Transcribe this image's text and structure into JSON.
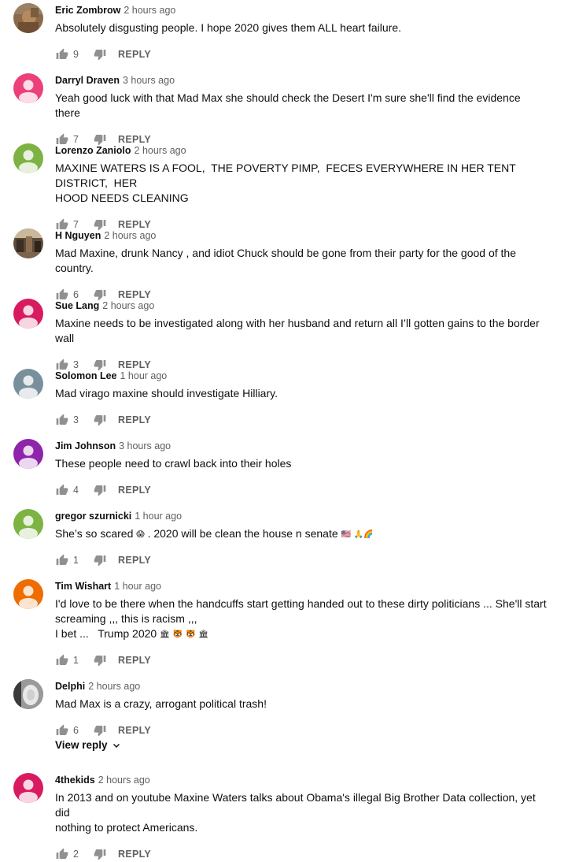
{
  "actions": {
    "reply_label": "REPLY"
  },
  "comments": [
    {
      "author": "Eric Zombrow",
      "time": "2 hours ago",
      "text": "Absolutely disgusting people. I hope 2020 gives them ALL heart failure.",
      "likes": "9",
      "avatar": {
        "kind": "photo",
        "color": "#8a6a4a"
      }
    },
    {
      "author": "Darryl Draven",
      "time": "3 hours ago",
      "text": "Yeah good luck with that Mad Max she should check the Desert I'm sure she'll find the evidence there",
      "likes": "7",
      "avatar": {
        "kind": "default",
        "color": "#ec407a"
      }
    },
    {
      "author": "Lorenzo Zaniolo",
      "time": "2 hours ago",
      "text": "MAXINE WATERS IS A FOOL,  THE POVERTY PIMP,  FECES EVERYWHERE IN HER TENT DISTRICT,  HER\nHOOD NEEDS CLEANING",
      "likes": "7",
      "avatar": {
        "kind": "default",
        "color": "#7cb342"
      }
    },
    {
      "author": "H Nguyen",
      "time": "2 hours ago",
      "text": "Mad Maxine, drunk Nancy , and idiot Chuck should be gone from their party for the good of the country.",
      "likes": "6",
      "avatar": {
        "kind": "photo",
        "color": "#5d4a38"
      }
    },
    {
      "author": "Sue Lang",
      "time": "2 hours ago",
      "text": "Maxine needs to be investigated along with her husband and return all I’ll gotten gains to the border wall",
      "likes": "3",
      "avatar": {
        "kind": "default",
        "color": "#d81b60"
      }
    },
    {
      "author": "Solomon Lee",
      "time": "1 hour ago",
      "text": "Mad virago maxine should investigate Hilliary.",
      "likes": "3",
      "avatar": {
        "kind": "default",
        "color": "#78909c"
      }
    },
    {
      "author": "Jim Johnson",
      "time": "3 hours ago",
      "text": "These people need to crawl back into their holes",
      "likes": "4",
      "avatar": {
        "kind": "default",
        "color": "#8e24aa"
      }
    },
    {
      "author": "gregor szurnicki",
      "time": "1 hour ago",
      "text": "She’s so scared",
      "likes": "1",
      "avatar": {
        "kind": "default",
        "color": "#7cb342"
      }
    },
    {
      "author": "Tim Wishart",
      "time": "1 hour ago",
      "text": "I'd love to be there when the handcuffs start getting handed out to these dirty politicians ... She'll start\nscreaming ,,, this is racism ,,,\nI bet ...   Trump 2020",
      "likes": "1",
      "avatar": {
        "kind": "default",
        "color": "#ef6c00"
      }
    },
    {
      "author": "Delphi",
      "time": "2 hours ago",
      "text": "Mad Max is a crazy, arrogant political trash!",
      "likes": "6",
      "avatar": {
        "kind": "photo",
        "color": "#6b6b6b"
      }
    },
    {
      "author": "4thekids",
      "time": "2 hours ago",
      "text": "In 2013 and on youtube Maxine Waters talks about Obama's illegal Big Brother Data collection, yet did\nnothing to protect Americans.",
      "likes": "2",
      "avatar": {
        "kind": "default",
        "color": "#d81b60"
      }
    }
  ],
  "extra_text": {
    "gregor_tail": " . 2020 will be clean the house n senate "
  },
  "emoji": {
    "scared": "😱",
    "flag": "🇺🇸",
    "pray": "🙏",
    "rainbow": "🌈",
    "building": "🏛",
    "tiger": "🐯"
  },
  "view_reply": {
    "label": "View reply"
  },
  "icons": {
    "like": "thumbs-up-icon",
    "dislike": "thumbs-down-icon",
    "chevron": "chevron-down-icon"
  }
}
